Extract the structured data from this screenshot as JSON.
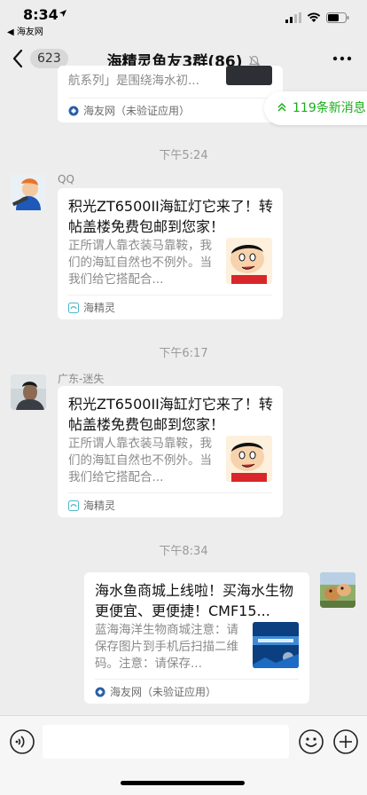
{
  "status_bar": {
    "time": "8:34",
    "back_app": "◀ 海友网"
  },
  "nav": {
    "back_count": "623",
    "title": "海精灵鱼友3群(86)"
  },
  "new_messages": "119条新消息",
  "messages": [
    {
      "desc_tail": "航系列」是围绕海水初...",
      "source": "海友网（未验证应用）"
    },
    {
      "timestamp": "下午5:24",
      "sender": "QQ",
      "title": "积光ZT6500II海缸灯它来了！转帖盖楼免费包邮到您家！",
      "desc": "正所谓人靠衣装马靠鞍，我们的海缸自然也不例外。当我们给它搭配合...",
      "source": "海精灵"
    },
    {
      "timestamp": "下午6:17",
      "sender": "广东-迷失",
      "title": "积光ZT6500II海缸灯它来了！转帖盖楼免费包邮到您家！",
      "desc": "正所谓人靠衣装马靠鞍，我们的海缸自然也不例外。当我们给它搭配合...",
      "source": "海精灵"
    },
    {
      "timestamp": "下午8:34",
      "title": "海水鱼商城上线啦！买海水生物更便宜、更便捷！CMF15...",
      "desc": "蓝海海洋生物商城注意：请保存图片到手机后扫描二维码。注意：请保存...",
      "source": "海友网（未验证应用）"
    }
  ],
  "colors": {
    "background": "#ededed",
    "accent_green": "#1aad19"
  }
}
